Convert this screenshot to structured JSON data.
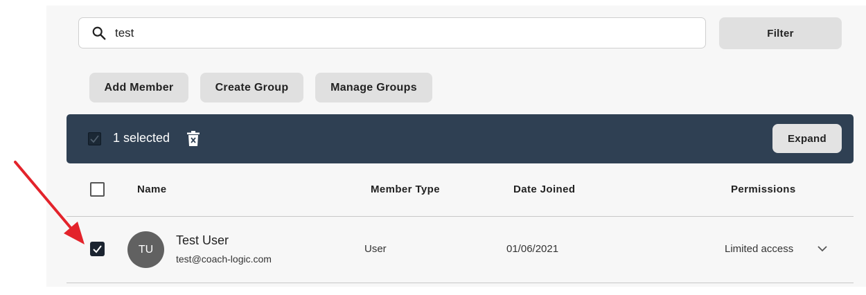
{
  "search": {
    "value": "test",
    "icon": "search-icon"
  },
  "buttons": {
    "filter": "Filter",
    "add_member": "Add Member",
    "create_group": "Create Group",
    "manage_groups": "Manage Groups"
  },
  "selection_bar": {
    "count_text": "1 selected",
    "delete_icon": "trash-icon",
    "expand": "Expand",
    "checked": true
  },
  "table": {
    "columns": [
      "Name",
      "Member Type",
      "Date Joined",
      "Permissions"
    ],
    "rows": [
      {
        "initials": "TU",
        "name": "Test User",
        "email": "test@coach-logic.com",
        "member_type": "User",
        "date_joined": "01/06/2021",
        "permissions": "Limited access",
        "selected": true
      }
    ]
  },
  "colors": {
    "selection_bar": "#2f4053",
    "annotation_arrow": "#e3232b",
    "avatar": "#616161"
  }
}
